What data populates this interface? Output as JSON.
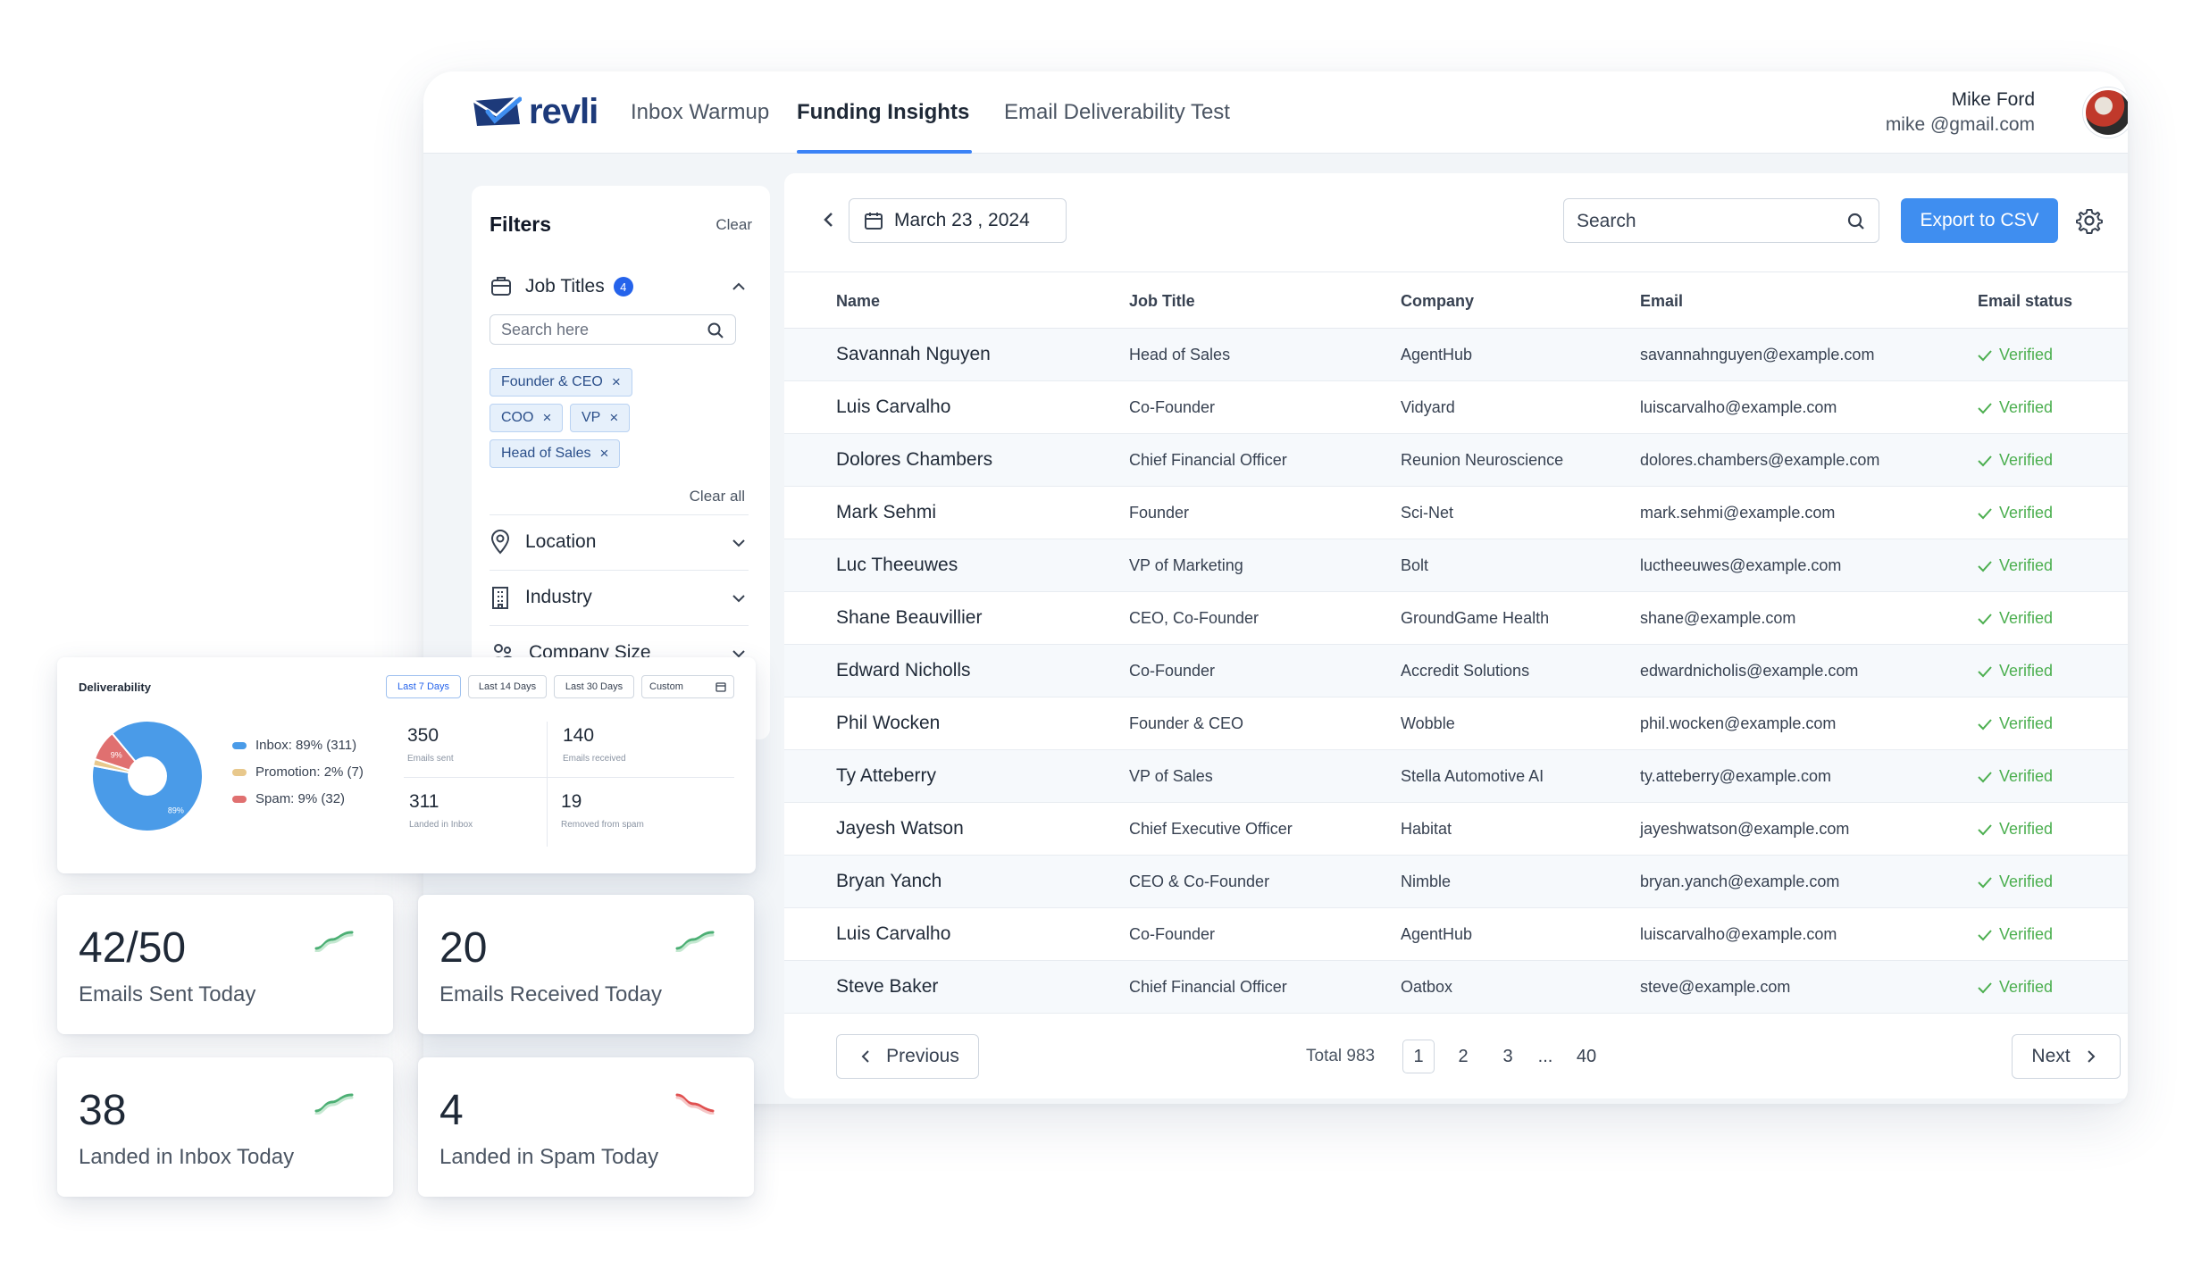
{
  "brand": {
    "name": "revli"
  },
  "nav": {
    "tabs": [
      {
        "label": "Inbox Warmup"
      },
      {
        "label": "Funding Insights"
      },
      {
        "label": "Email Deliverability Test"
      }
    ],
    "active_tab": "Funding Insights"
  },
  "user": {
    "name": "Mike Ford",
    "email": "mike @gmail.com"
  },
  "filters": {
    "title": "Filters",
    "clear_label": "Clear",
    "job_titles": {
      "label": "Job Titles",
      "count": "4",
      "search_placeholder": "Search here",
      "chips": [
        "Founder & CEO",
        "COO",
        "VP",
        "Head of Sales"
      ],
      "clear_all_label": "Clear all"
    },
    "sections": [
      {
        "label": "Location",
        "icon": "map-pin-icon"
      },
      {
        "label": "Industry",
        "icon": "building-icon"
      },
      {
        "label": "Company Size",
        "icon": "people-icon"
      }
    ]
  },
  "toolbar": {
    "date": "March 23 , 2024",
    "search_placeholder": "Search",
    "export_label": "Export to CSV"
  },
  "table": {
    "columns": [
      "Name",
      "Job Title",
      "Company",
      "Email",
      "Email status"
    ],
    "rows": [
      {
        "name": "Savannah Nguyen",
        "title": "Head of Sales",
        "company": "AgentHub",
        "email": "savannahnguyen@example.com",
        "status": "Verified"
      },
      {
        "name": "Luis Carvalho",
        "title": "Co-Founder",
        "company": "Vidyard",
        "email": "luiscarvalho@example.com",
        "status": "Verified"
      },
      {
        "name": "Dolores Chambers",
        "title": "Chief Financial Officer",
        "company": "Reunion Neuroscience",
        "email": "dolores.chambers@example.com",
        "status": "Verified"
      },
      {
        "name": "Mark Sehmi",
        "title": "Founder",
        "company": "Sci-Net",
        "email": "mark.sehmi@example.com",
        "status": "Verified"
      },
      {
        "name": "Luc Theeuwes",
        "title": "VP of Marketing",
        "company": "Bolt",
        "email": "luctheeuwes@example.com",
        "status": "Verified"
      },
      {
        "name": "Shane Beauvillier",
        "title": "CEO, Co-Founder",
        "company": "GroundGame Health",
        "email": "shane@example.com",
        "status": "Verified"
      },
      {
        "name": "Edward Nicholls",
        "title": "Co-Founder",
        "company": "Accredit Solutions",
        "email": "edwardnicholis@example.com",
        "status": "Verified"
      },
      {
        "name": "Phil Wocken",
        "title": "Founder & CEO",
        "company": "Wobble",
        "email": "phil.wocken@example.com",
        "status": "Verified"
      },
      {
        "name": "Ty Atteberry",
        "title": "VP of Sales",
        "company": "Stella Automotive AI",
        "email": "ty.atteberry@example.com",
        "status": "Verified"
      },
      {
        "name": "Jayesh Watson",
        "title": "Chief Executive Officer",
        "company": "Habitat",
        "email": "jayeshwatson@example.com",
        "status": "Verified"
      },
      {
        "name": "Bryan Yanch",
        "title": "CEO & Co-Founder",
        "company": "Nimble",
        "email": "bryan.yanch@example.com",
        "status": "Verified"
      },
      {
        "name": "Luis Carvalho",
        "title": "Co-Founder",
        "company": "AgentHub",
        "email": "luiscarvalho@example.com",
        "status": "Verified"
      },
      {
        "name": "Steve Baker",
        "title": "Chief Financial Officer",
        "company": "Oatbox",
        "email": "steve@example.com",
        "status": "Verified"
      }
    ]
  },
  "pagination": {
    "previous_label": "Previous",
    "next_label": "Next",
    "total_label": "Total 983",
    "pages": [
      "1",
      "2",
      "3",
      "...",
      "40"
    ],
    "current_page": "1"
  },
  "deliverability": {
    "title": "Deliverability",
    "tabs": [
      "Last 7 Days",
      "Last 14 Days",
      "Last 30 Days",
      "Custom"
    ],
    "active_tab": "Last 7 Days",
    "legend": [
      {
        "label": "Inbox: 89% (311)",
        "color": "#4a9be8"
      },
      {
        "label": "Promotion: 2% (7)",
        "color": "#e8c88c"
      },
      {
        "label": "Spam: 9% (32)",
        "color": "#e07070"
      }
    ],
    "pie_labels": {
      "inbox": "89%",
      "spam": "9%"
    },
    "stats": [
      {
        "value": "350",
        "label": "Emails sent"
      },
      {
        "value": "140",
        "label": "Emails received"
      },
      {
        "value": "311",
        "label": "Landed in Inbox"
      },
      {
        "value": "19",
        "label": "Removed from spam"
      }
    ]
  },
  "chart_data": {
    "type": "pie",
    "title": "Deliverability",
    "slices": [
      {
        "name": "Inbox",
        "percent": 89,
        "count": 311,
        "color": "#4a9be8"
      },
      {
        "name": "Promotion",
        "percent": 2,
        "count": 7,
        "color": "#e8c88c"
      },
      {
        "name": "Spam",
        "percent": 9,
        "count": 32,
        "color": "#e07070"
      }
    ]
  },
  "kpis": [
    {
      "value": "42/50",
      "label": "Emails Sent Today",
      "trend": "up"
    },
    {
      "value": "20",
      "label": "Emails Received Today",
      "trend": "up"
    },
    {
      "value": "38",
      "label": "Landed in Inbox Today",
      "trend": "up"
    },
    {
      "value": "4",
      "label": "Landed in Spam Today",
      "trend": "down"
    }
  ],
  "colors": {
    "accent": "#3f8ef0",
    "verified": "#4caf50",
    "trend_up": "#4caf74",
    "trend_down": "#e05050",
    "brand": "#1d3a7a"
  }
}
